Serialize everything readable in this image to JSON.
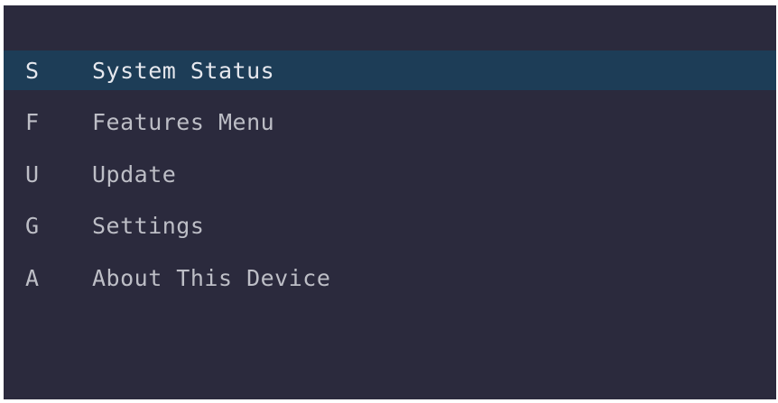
{
  "menu": {
    "items": [
      {
        "hotkey": "S",
        "label": "System Status",
        "selected": true
      },
      {
        "hotkey": "F",
        "label": "Features Menu",
        "selected": false
      },
      {
        "hotkey": "U",
        "label": "Update",
        "selected": false
      },
      {
        "hotkey": "G",
        "label": "Settings",
        "selected": false
      },
      {
        "hotkey": "A",
        "label": "About This Device",
        "selected": false
      }
    ]
  },
  "colors": {
    "background": "#2b2a3d",
    "selected_row": "#1d3d57",
    "text": "#bdbec6",
    "selected_text": "#e6e8ee"
  }
}
